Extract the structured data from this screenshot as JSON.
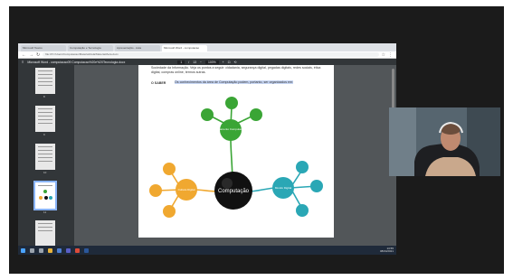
{
  "browser": {
    "tabs": [
      "Microsoft Teams",
      "Computação e Tecnologia",
      "Apresentação - Aula",
      "Microsoft Word - computacao"
    ],
    "url": "file:///C:/Users/Computacao/Material/Aula/Material/Aula.docx"
  },
  "pdf_viewer": {
    "title": "Microsoft Word - computacao09 Computacao%20e%20Tecnologia.docx",
    "page_current": "1",
    "page_total": "13",
    "zoom": "100%"
  },
  "document": {
    "body_text": "Sociedade da Informação. Veja os pontos a seguir: cidadania, segurança digital, pegadas digitais, redes sociais, ética digital, compras online, termos sutras.",
    "heading": "O SABER",
    "selected_text": "Os conhecimentos da área de Computação podem, portanto, ser organizados em:",
    "mindmap": {
      "center": "Computação",
      "branches": [
        {
          "label": "Pensamento Computacional",
          "color": "#3aa535"
        },
        {
          "label": "Cultura Digital",
          "color": "#f0a830"
        },
        {
          "label": "Mundo Digital",
          "color": "#2aa7b5"
        }
      ]
    }
  },
  "thumbnails": {
    "page_numbers": [
      "8",
      "9",
      "10",
      "11"
    ]
  },
  "taskbar": {
    "time": "13:55",
    "date": "08/04/2021"
  },
  "colors": {
    "green": "#3aa535",
    "orange": "#f0a830",
    "teal": "#2aa7b5",
    "center": "#111111"
  }
}
